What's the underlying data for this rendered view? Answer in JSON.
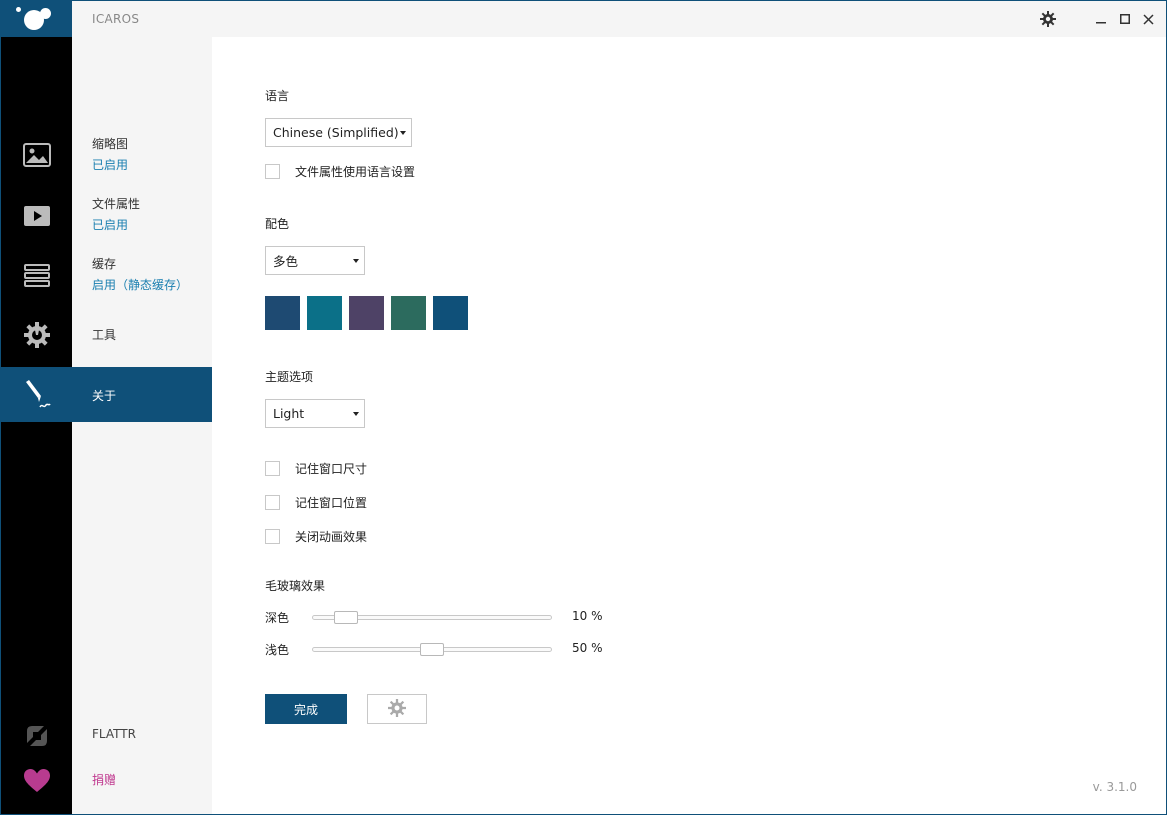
{
  "window": {
    "title": "ICAROS"
  },
  "sidebar": {
    "items": [
      {
        "label": "缩略图",
        "status": "已启用"
      },
      {
        "label": "文件属性",
        "status": "已启用"
      },
      {
        "label": "缓存",
        "status": "启用（静态缓存）"
      },
      {
        "label": "工具"
      },
      {
        "label": "关于"
      }
    ],
    "flattr_label": "FLATTR",
    "donate_label": "捐赠",
    "active_index": 4
  },
  "settings": {
    "language": {
      "heading": "语言",
      "selected": "Chinese (Simplified)",
      "checkbox_label": "文件属性使用语言设置",
      "checkbox_checked": false
    },
    "color": {
      "heading": "配色",
      "selected": "多色",
      "swatches": [
        "#1e4a72",
        "#0b7088",
        "#4e4266",
        "#2c6b5e",
        "#0f5079"
      ]
    },
    "theme": {
      "heading": "主题选项",
      "selected": "Light"
    },
    "options": [
      {
        "label": "记住窗口尺寸",
        "checked": false
      },
      {
        "label": "记住窗口位置",
        "checked": false
      },
      {
        "label": "关闭动画效果",
        "checked": false
      }
    ],
    "blur": {
      "heading": "毛玻璃效果",
      "sliders": [
        {
          "label": "深色",
          "value_text": "10 %",
          "value": 10
        },
        {
          "label": "浅色",
          "value_text": "50 %",
          "value": 50
        }
      ]
    },
    "done_label": "完成"
  },
  "version": "v. 3.1.0",
  "colors": {
    "accent": "#0f5079",
    "link": "#1a7fb0",
    "donate": "#c0398f"
  }
}
